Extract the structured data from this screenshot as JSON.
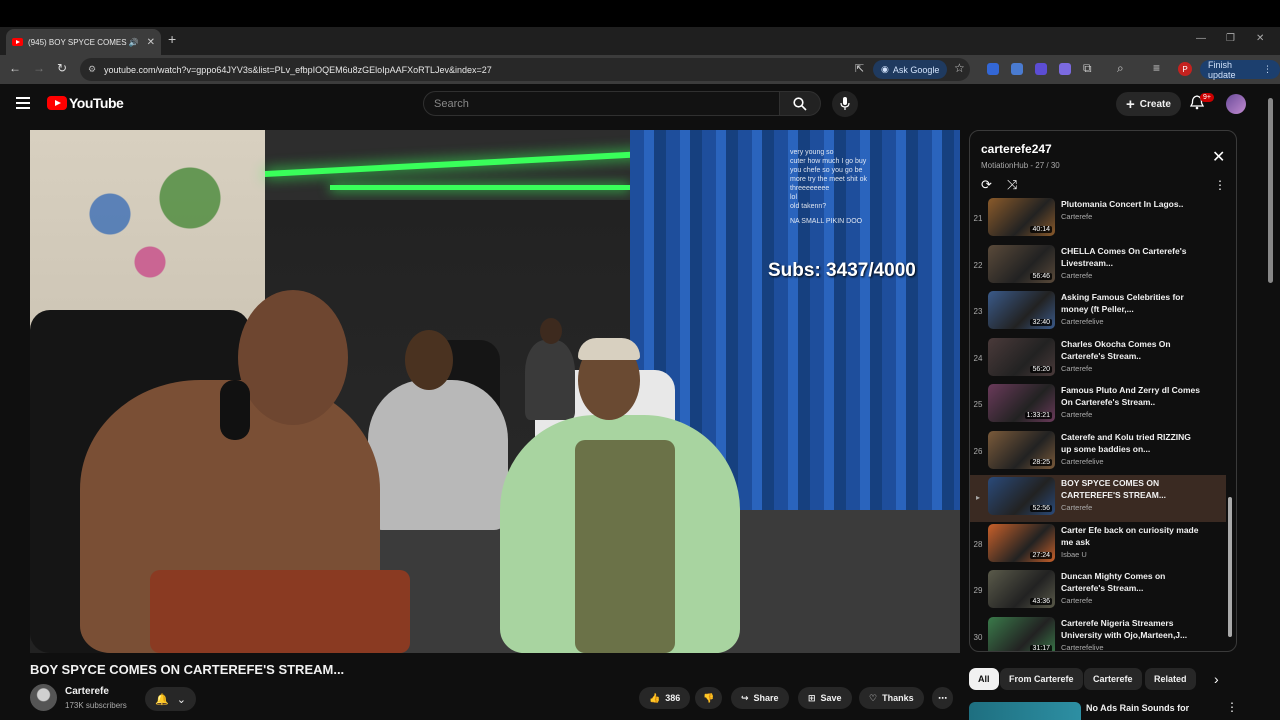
{
  "browser": {
    "tab_title": "(945) BOY SPYCE COMES O",
    "url": "youtube.com/watch?v=gppo64JYV3s&list=PLv_efbpIOQEM6u8zGEloIpAAFXoRTLJev&index=27",
    "ask_google": "Ask Google",
    "finish_update": "Finish update",
    "profile_letter": "P"
  },
  "header": {
    "logo_text": "YouTube",
    "search_placeholder": "Search",
    "create_label": "Create",
    "notifications": "9+"
  },
  "video": {
    "overlay_subs": "Subs: 3437/4000",
    "chat_lines": [
      {
        "name": "",
        "text": "very young so"
      },
      {
        "name": "",
        "text": "cuter how much I go buy"
      },
      {
        "name": "",
        "text": "you chefe so you go be"
      },
      {
        "name": "",
        "text": "more try the meet shit ok"
      },
      {
        "name": "",
        "text": "threeeeeeee"
      },
      {
        "name": "",
        "text": "lol"
      },
      {
        "name": "",
        "text": "old takenn?"
      },
      {
        "name": "",
        "text": "NA SMALL PIKIN DOO"
      }
    ],
    "title": "BOY SPYCE COMES ON CARTEREFE'S STREAM...",
    "channel_name": "Carterefe",
    "subscribers": "173K subscribers",
    "likes": "386",
    "share_label": "Share",
    "save_label": "Save",
    "thanks_label": "Thanks"
  },
  "playlist": {
    "title": "carterefe247",
    "subtitle": "MotiationHub - 27 / 30",
    "items": [
      {
        "index": "21",
        "title": "Plutomania Concert In Lagos..",
        "channel": "Carterefe",
        "duration": "40:14",
        "color": "#8a5a2a"
      },
      {
        "index": "22",
        "title": "CHELLA Comes On Carterefe's Livestream...",
        "channel": "Carterefe",
        "duration": "56:46",
        "color": "#5a4a3a"
      },
      {
        "index": "23",
        "title": "Asking Famous Celebrities for money (ft Peller,...",
        "channel": "Carterefelive",
        "duration": "32:40",
        "color": "#3a5a8a"
      },
      {
        "index": "24",
        "title": "Charles Okocha Comes On Carterefe's Stream..",
        "channel": "Carterefe",
        "duration": "56:20",
        "color": "#4a3a3a"
      },
      {
        "index": "25",
        "title": "Famous Pluto And Zerry dl Comes On Carterefe's Stream..",
        "channel": "Carterefe",
        "duration": "1:33:21",
        "color": "#6a3a5a"
      },
      {
        "index": "26",
        "title": "Caterefe and Kolu tried RIZZING up some baddies on...",
        "channel": "Carterefelive",
        "duration": "28:25",
        "color": "#7a5a3a"
      },
      {
        "index": "▸",
        "title": "BOY SPYCE COMES ON CARTEREFE'S STREAM...",
        "channel": "Carterefe",
        "duration": "52:56",
        "color": "#2a4a7a",
        "active": true
      },
      {
        "index": "28",
        "title": "Carter Efe back on curiosity made me ask",
        "channel": "Isbae U",
        "duration": "27:24",
        "color": "#c8602a"
      },
      {
        "index": "29",
        "title": "Duncan Mighty Comes on Carterefe's Stream...",
        "channel": "Carterefe",
        "duration": "43:36",
        "color": "#5a5a4a"
      },
      {
        "index": "30",
        "title": "Carterefe Nigeria Streamers University with Ojo,Marteen,J...",
        "channel": "Carterefelive",
        "duration": "31:17",
        "color": "#3a7a4a"
      }
    ]
  },
  "chips": [
    "All",
    "From Carterefe",
    "Carterefe",
    "Related"
  ],
  "next_video": {
    "title": "No Ads Rain Sounds for"
  }
}
